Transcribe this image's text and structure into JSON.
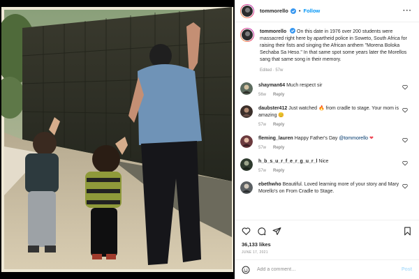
{
  "header": {
    "username": "tommorello",
    "separator": "•",
    "follow_label": "Follow",
    "more_label": "···"
  },
  "caption": {
    "username": "tommorello",
    "text": "On this date in 1976 over 200 students were massacred right here by apartheid police in Soweto, South Africa for raising their fists and singing the African anthem \"Morena Boloka Sechaba Sa Heso.\" In that same spot some years later the Morellos sang that same song in their memory.",
    "meta": "Edited · 57w"
  },
  "comments": [
    {
      "username": "shayman64",
      "text": "Much respect sir",
      "time": "56w",
      "reply": "Reply"
    },
    {
      "username": "daubster412",
      "text_before": "Just watched ",
      "text_after": " from cradle to stage. Your mom is amazing ",
      "emoji_1": "🔥",
      "emoji_2": "😊",
      "time": "57w",
      "reply": "Reply"
    },
    {
      "username": "fleming_lauren",
      "text": "Happy Father's Day ",
      "mention": "@tommorello",
      "emoji": "❤",
      "time": "57w",
      "reply": "Reply"
    },
    {
      "username": "h_b_s_u_r_f_e_r_g_u_r_l",
      "text": "Nice",
      "time": "57w",
      "reply": "Reply"
    },
    {
      "username": "ebethwho",
      "text": "Beautiful. Loved learning more of your story and Mary Morello's on From Cradle to Stage.",
      "time": "57w",
      "reply": "Reply"
    }
  ],
  "actions": {
    "likes": "36,133 likes",
    "date": "JUNE 17, 2021",
    "icons": [
      "heart-icon",
      "comment-icon",
      "share-icon",
      "bookmark-icon"
    ]
  },
  "add_comment": {
    "placeholder": "Add a comment…",
    "post_label": "Post"
  },
  "colors": {
    "accent": "#0095f6",
    "verified": "#3897f0",
    "heart": "#ed4956",
    "post_disabled": "#b2dffc"
  }
}
